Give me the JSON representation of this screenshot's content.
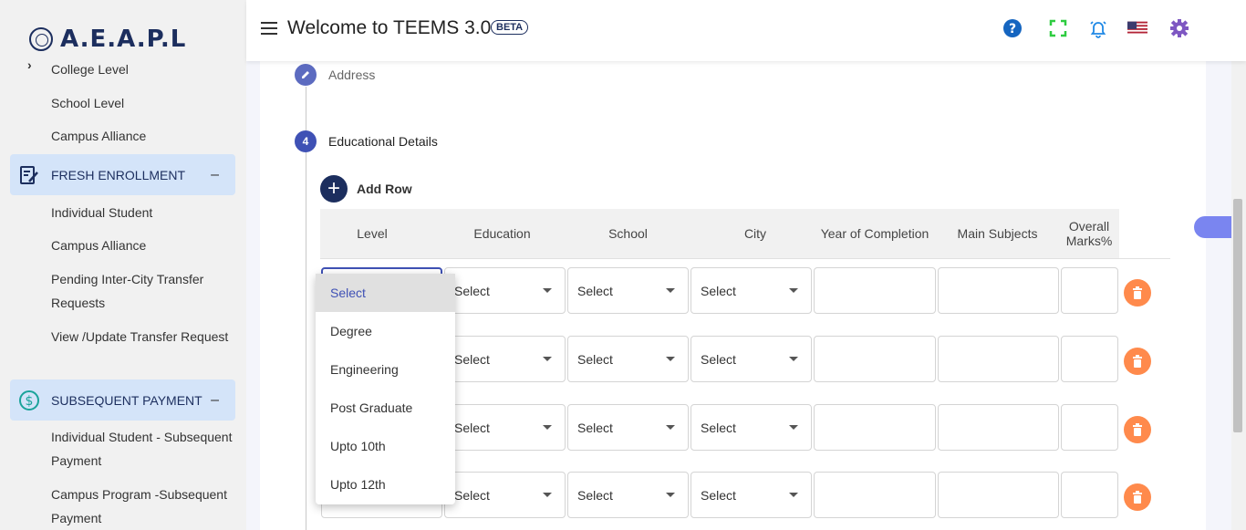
{
  "brand": {
    "logo_text": "A.E.A.P.L"
  },
  "header": {
    "title": "Welcome to TEEMS 3.0",
    "badge": "BETA"
  },
  "sidebar": {
    "items_top": [
      "College Level",
      "School Level",
      "Campus Alliance"
    ],
    "section_fresh": {
      "label": "FRESH ENROLLMENT",
      "toggle": "–"
    },
    "fresh_items": [
      "Individual Student",
      "Campus Alliance",
      "Pending Inter-City Transfer Requests",
      "View /Update Transfer Request"
    ],
    "section_payment": {
      "label": "SUBSEQUENT PAYMENT",
      "toggle": "–"
    },
    "payment_items": [
      "Individual Student - Subsequent Payment",
      "Campus Program -Subsequent Payment"
    ]
  },
  "form": {
    "step_address": {
      "label": "Address"
    },
    "step_education": {
      "number": "4",
      "label": "Educational Details"
    },
    "add_row_label": "Add Row",
    "columns": [
      "Level",
      "Education",
      "School",
      "City",
      "Year of Completion",
      "Main Subjects",
      "Overall Marks%"
    ],
    "select_placeholder": "Select",
    "rows": [
      {
        "education": "Select",
        "school": "Select",
        "city": "Select"
      },
      {
        "education": "Select",
        "school": "Select",
        "city": "Select"
      },
      {
        "education": "Select",
        "school": "Select",
        "city": "Select"
      },
      {
        "education": "Select",
        "school": "Select",
        "city": "Select"
      }
    ]
  },
  "level_dropdown": {
    "options": [
      "Select",
      "Degree",
      "Engineering",
      "Post Graduate",
      "Upto 10th",
      "Upto 12th"
    ],
    "selected": "Select"
  },
  "colors": {
    "primary": "#1c2e5e",
    "accent": "#3f51b5",
    "delete": "#ff8a4c",
    "section_bg": "#d4e4f9"
  }
}
